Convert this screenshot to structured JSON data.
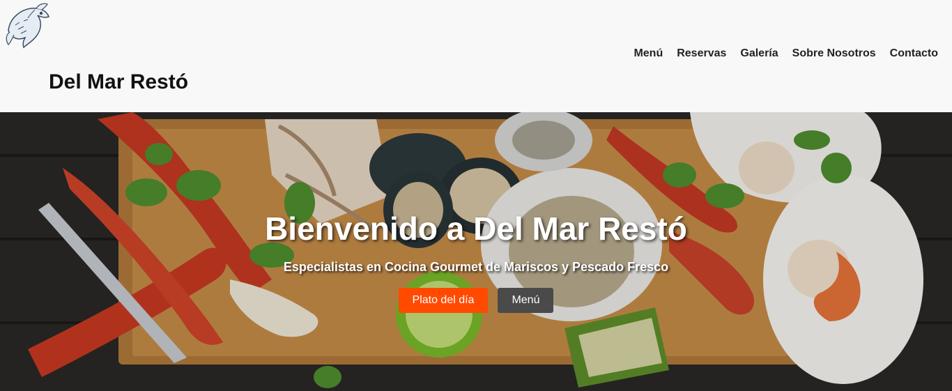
{
  "header": {
    "logo_icon": "fish-logo-icon",
    "brand": "Del Mar Restó",
    "nav": [
      {
        "label": "Menú"
      },
      {
        "label": "Reservas"
      },
      {
        "label": "Galería"
      },
      {
        "label": "Sobre Nosotros"
      },
      {
        "label": "Contacto"
      }
    ]
  },
  "hero": {
    "image": "seafood-platter-photo",
    "title": "Bienvenido a Del Mar Restó",
    "subtitle": "Especialistas en Cocina Gourmet de Mariscos y Pescado Fresco",
    "buttons": {
      "primary_label": "Plato del día",
      "secondary_label": "Menú"
    }
  },
  "colors": {
    "primary_button": "#ff4a00",
    "secondary_button": "#4a4a4a",
    "header_bg": "#f8f8f8"
  }
}
